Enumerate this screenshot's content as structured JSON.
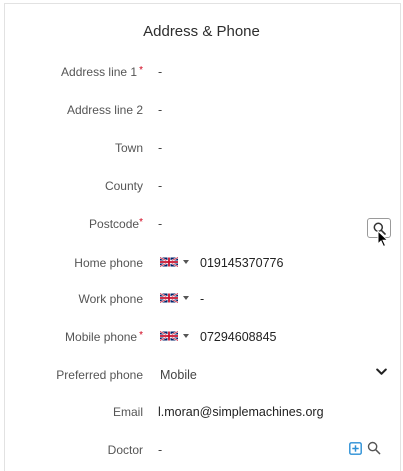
{
  "title": "Address & Phone",
  "fields": {
    "address1": {
      "label": "Address line 1",
      "required_mark": "*",
      "value": "-"
    },
    "address2": {
      "label": "Address line 2",
      "value": "-"
    },
    "town": {
      "label": "Town",
      "value": "-"
    },
    "county": {
      "label": "County",
      "value": "-"
    },
    "postcode": {
      "label": "Postcode",
      "required_mark": "*",
      "value": "-"
    },
    "home_phone": {
      "label": "Home phone",
      "country": "UK flag",
      "value": "019145370776"
    },
    "work_phone": {
      "label": "Work phone",
      "country": "UK flag",
      "value": "-"
    },
    "mobile_phone": {
      "label": "Mobile phone",
      "required_mark": "*",
      "country": "UK flag",
      "value": "07294608845"
    },
    "preferred_phone": {
      "label": "Preferred phone",
      "value": "Mobile"
    },
    "email": {
      "label": "Email",
      "value": "l.moran@simplemachines.org"
    },
    "doctor": {
      "label": "Doctor",
      "value": "-"
    }
  },
  "icons": {
    "postcode_lookup": "search-icon",
    "preferred_dropdown": "chevron-down-icon",
    "doctor_add": "add-box-icon",
    "doctor_search": "search-icon",
    "cursor": "mouse-pointer-icon"
  },
  "colors": {
    "required": "#d0021b",
    "accent": "#2a8fd6"
  }
}
